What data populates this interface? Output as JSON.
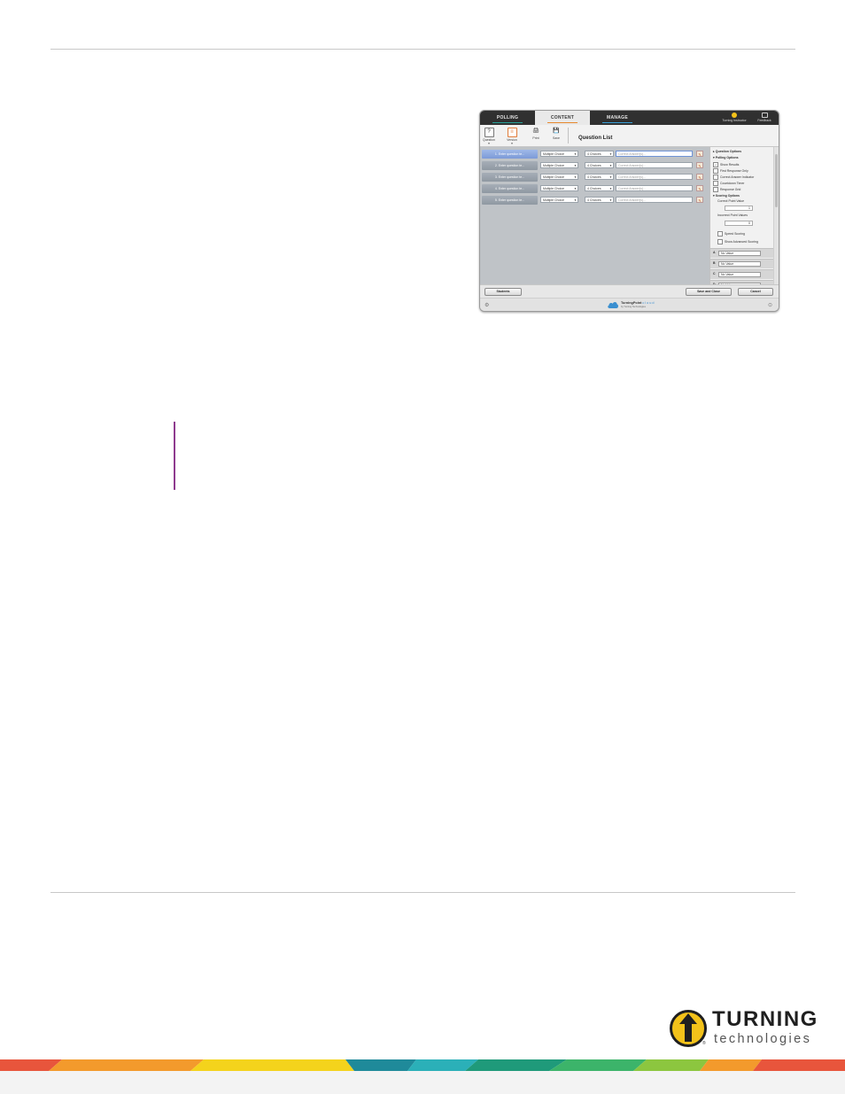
{
  "app": {
    "tabs": [
      {
        "label": "POLLING",
        "active": false,
        "accent": "#2aa198"
      },
      {
        "label": "CONTENT",
        "active": true,
        "accent": "#e6892e"
      },
      {
        "label": "MANAGE",
        "active": false,
        "accent": "#3aa0d8"
      }
    ],
    "topbar_right": [
      {
        "label": "Turning Instructor",
        "icon": "turning-icon"
      },
      {
        "label": "Feedback",
        "icon": "feedback-icon"
      }
    ],
    "toolbar": {
      "question_label": "Question",
      "version_label": "Version",
      "print_label": "Print",
      "save_label": "Save"
    },
    "list_title": "Question List",
    "questions": [
      {
        "label": "1. Enter question te...",
        "type": "Multiple Choice",
        "choices": "4 Choices",
        "answer_placeholder": "Correct Answer(s)...",
        "selected": true
      },
      {
        "label": "2. Enter question te...",
        "type": "Multiple Choice",
        "choices": "4 Choices",
        "answer_placeholder": "Correct Answer(s)...",
        "selected": false
      },
      {
        "label": "3. Enter question te...",
        "type": "Multiple Choice",
        "choices": "4 Choices",
        "answer_placeholder": "Correct Answer(s)...",
        "selected": false
      },
      {
        "label": "4. Enter question te...",
        "type": "Multiple Choice",
        "choices": "4 Choices",
        "answer_placeholder": "Correct Answer(s)...",
        "selected": false
      },
      {
        "label": "5. Enter question te...",
        "type": "Multiple Choice",
        "choices": "4 Choices",
        "answer_placeholder": "Correct Answer(s)...",
        "selected": false
      }
    ],
    "side": {
      "question_options": "Question Options",
      "polling_options": "Polling Options",
      "show_results": "Show Results",
      "first_response_only": "First Response Only",
      "correct_answer_indicator": "Correct Answer Indicator",
      "countdown_timer": "Countdown Timer",
      "response_grid": "Response Grid",
      "scoring_options": "Scoring Options",
      "correct_point_value_label": "Correct Point Value",
      "correct_point_value": "1",
      "incorrect_point_values_label": "Incorrect Point Values",
      "incorrect_point_value": "0",
      "speed_scoring": "Speed Scoring",
      "show_advanced_scoring": "Show Advanced Scoring",
      "choices": [
        {
          "letter": "A",
          "value": "No Value"
        },
        {
          "letter": "B",
          "value": "No Value"
        },
        {
          "letter": "C",
          "value": "No Value"
        },
        {
          "letter": "D",
          "value": "No Value"
        }
      ]
    },
    "bottom": {
      "students_label": "Students",
      "save_close_label": "Save and Close",
      "cancel_label": "Cancel"
    },
    "footer": {
      "brand": "TurningPoint",
      "brand_cloud": "cloud",
      "by": "by Turning Technologies"
    }
  },
  "logo": {
    "line1": "TURNING",
    "line2": "technologies"
  },
  "colors": {
    "accent_purple": "#8e3a8e",
    "logo_yellow": "#f3c21a"
  }
}
